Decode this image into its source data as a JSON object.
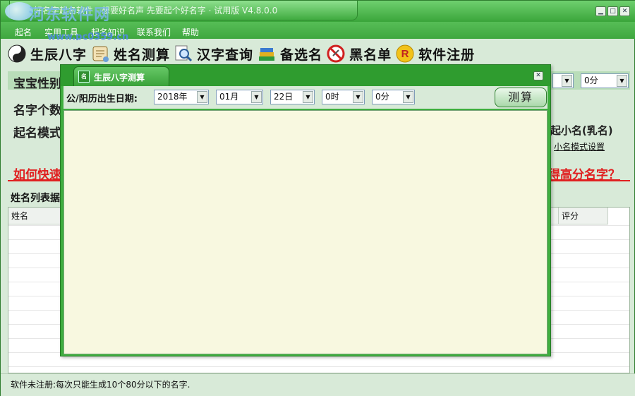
{
  "app": {
    "title": "好名字起名软件 - 想要好名声 先要起个好名字 · 试用版 V4.8.0.0",
    "watermark": "河东软件网",
    "watermark_url": "www.pc0359.cn"
  },
  "window_buttons": {
    "minimize": "▁",
    "maximize": "□",
    "close": "✕"
  },
  "menu": [
    {
      "label": "起名"
    },
    {
      "label": "实用工具"
    },
    {
      "label": "起名知识"
    },
    {
      "label": "联系我们"
    },
    {
      "label": "帮助"
    }
  ],
  "toolbar": [
    {
      "label": "生辰八字",
      "icon": "yin-yang-icon"
    },
    {
      "label": "姓名测算",
      "icon": "scroll-icon"
    },
    {
      "label": "汉字查询",
      "icon": "magnifier-icon"
    },
    {
      "label": "备选名",
      "icon": "books-icon"
    },
    {
      "label": "黑名单",
      "icon": "forbidden-icon"
    },
    {
      "label": "软件注册",
      "icon": "registered-icon"
    }
  ],
  "main": {
    "gender_label": "宝宝性别",
    "name_count_label": "名字个数",
    "mode_label": "起名模式",
    "right_minute_select": "0分",
    "nickname_radio": "起小名(乳名)",
    "nickname_settings": "小名模式设置",
    "help_link_left": "如何快速",
    "help_link_right": "得高分名字？",
    "list_section": "姓名列表据"
  },
  "table": {
    "columns": [
      "姓名",
      "评分"
    ]
  },
  "status": {
    "text": "软件未注册:每次只能生成10个80分以下的名字."
  },
  "dialog": {
    "title": "生辰八字测算",
    "date_label": "公/阳历出生日期:",
    "year": "2018年",
    "month": "01月",
    "day": "22日",
    "hour": "0时",
    "minute": "0分",
    "calc_button": "测算",
    "close": "✕"
  },
  "colors": {
    "window_green": "#3fae3f",
    "panel_bg": "#d8ead8",
    "result_bg": "#f8f8e0",
    "link_red": "#e02020"
  }
}
